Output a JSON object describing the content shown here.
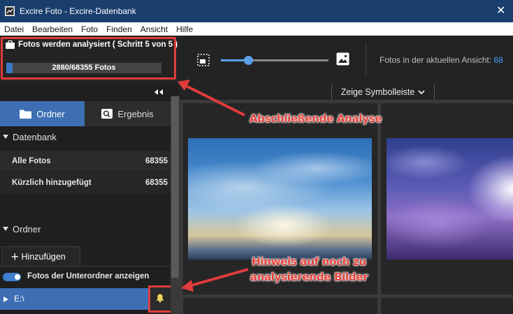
{
  "window": {
    "title": "Excire Foto - Excire-Datenbank",
    "close_glyph": "✕"
  },
  "menu": [
    "Datei",
    "Bearbeiten",
    "Foto",
    "Finden",
    "Ansicht",
    "Hilfe"
  ],
  "analysis": {
    "title": "Fotos werden analysiert ( Schritt 5 von 5 )",
    "progress_text": "2880/68355 Fotos",
    "progress_fraction": 0.0421
  },
  "toolbar": {
    "photos_in_view_label": "Fotos in der aktuellen Ansicht:",
    "photos_in_view_value": "68",
    "zoom_level": 0.25
  },
  "sidebar": {
    "tabs": [
      {
        "label": "Ordner",
        "icon": "folder-icon",
        "active": true
      },
      {
        "label": "Ergebnis",
        "icon": "search-icon",
        "active": false
      }
    ],
    "database_section": "Datenbank",
    "database_rows": [
      {
        "label": "Alle Fotos",
        "count": "68355"
      },
      {
        "label": "Kürzlich hinzugefügt",
        "count": "68355"
      }
    ],
    "folder_section": "Ordner",
    "add_button": "Hinzufügen",
    "subfolder_toggle_label": "Fotos der Unterordner anzeigen",
    "folders": [
      {
        "label": "E:\\"
      }
    ]
  },
  "grid": {
    "show_toolbar": "Zeige Symbolleiste"
  },
  "annotations": {
    "analysis_note": "Abschließende Analyse",
    "hint_line1": "Hinweis auf noch zu",
    "hint_line2": "analysierende Bilder",
    "color": "#e03c3c"
  },
  "colors": {
    "accent": "#3e6fb4",
    "titlebar": "#1a3f6e",
    "link_blue": "#4aa3ff"
  }
}
